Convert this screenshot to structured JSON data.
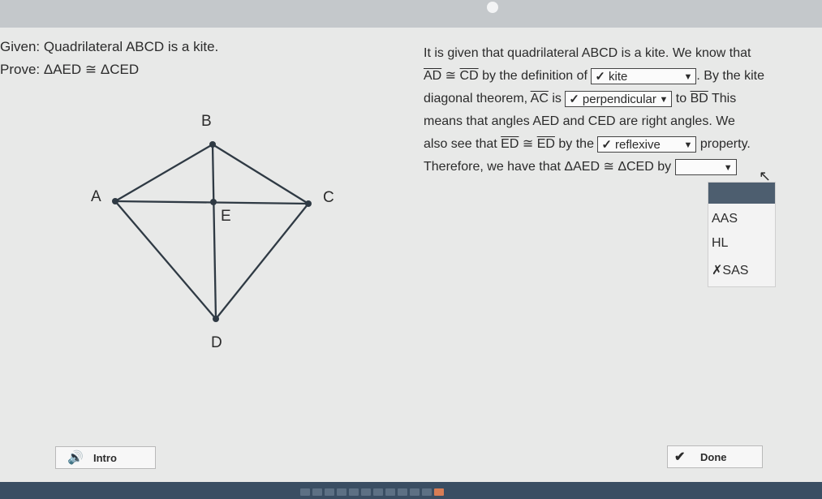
{
  "given": "Given: Quadrilateral ABCD is a kite.",
  "prove": "Prove: ΔAED ≅ ΔCED",
  "figure": {
    "labels": {
      "A": "A",
      "B": "B",
      "C": "C",
      "D": "D",
      "E": "E"
    }
  },
  "paragraph": {
    "l1": "It is given that quadrilateral ABCD is a kite. We know that",
    "l2_seg1": "AD",
    "l2_cong": " ≅ ",
    "l2_seg2": "CD",
    "l2_after": " by the definition of ",
    "l2_tail": ". By the kite",
    "l3_pre": "diagonal theorem, ",
    "l3_seg": "AC",
    "l3_is": " is ",
    "l3_to": " to ",
    "l3_seg2": "BD",
    "l3_tail": " This",
    "l4": "means that angles AED and CED are right angles. We",
    "l5_pre": "also see that ",
    "l5_seg1": "ED",
    "l5_cong": " ≅ ",
    "l5_seg2": "ED",
    "l5_by": " by the ",
    "l5_tail": " property.",
    "l6_pre": "Therefore, we have that ΔAED ≅ ΔCED by "
  },
  "dropdowns": {
    "kite": {
      "check": "✓",
      "value": "kite"
    },
    "perpendicular": {
      "check": "✓",
      "value": "perpendicular"
    },
    "reflexive": {
      "check": "✓",
      "value": "reflexive"
    },
    "final": {
      "value": ""
    }
  },
  "menu": {
    "options": [
      "AAS",
      "HL",
      "✗SAS"
    ]
  },
  "buttons": {
    "intro": "Intro",
    "done": "Done"
  },
  "icons": {
    "speaker": "speaker-icon",
    "check": "check-icon",
    "cursor": "pointer-cursor-icon",
    "caret": "chevron-down-icon"
  }
}
